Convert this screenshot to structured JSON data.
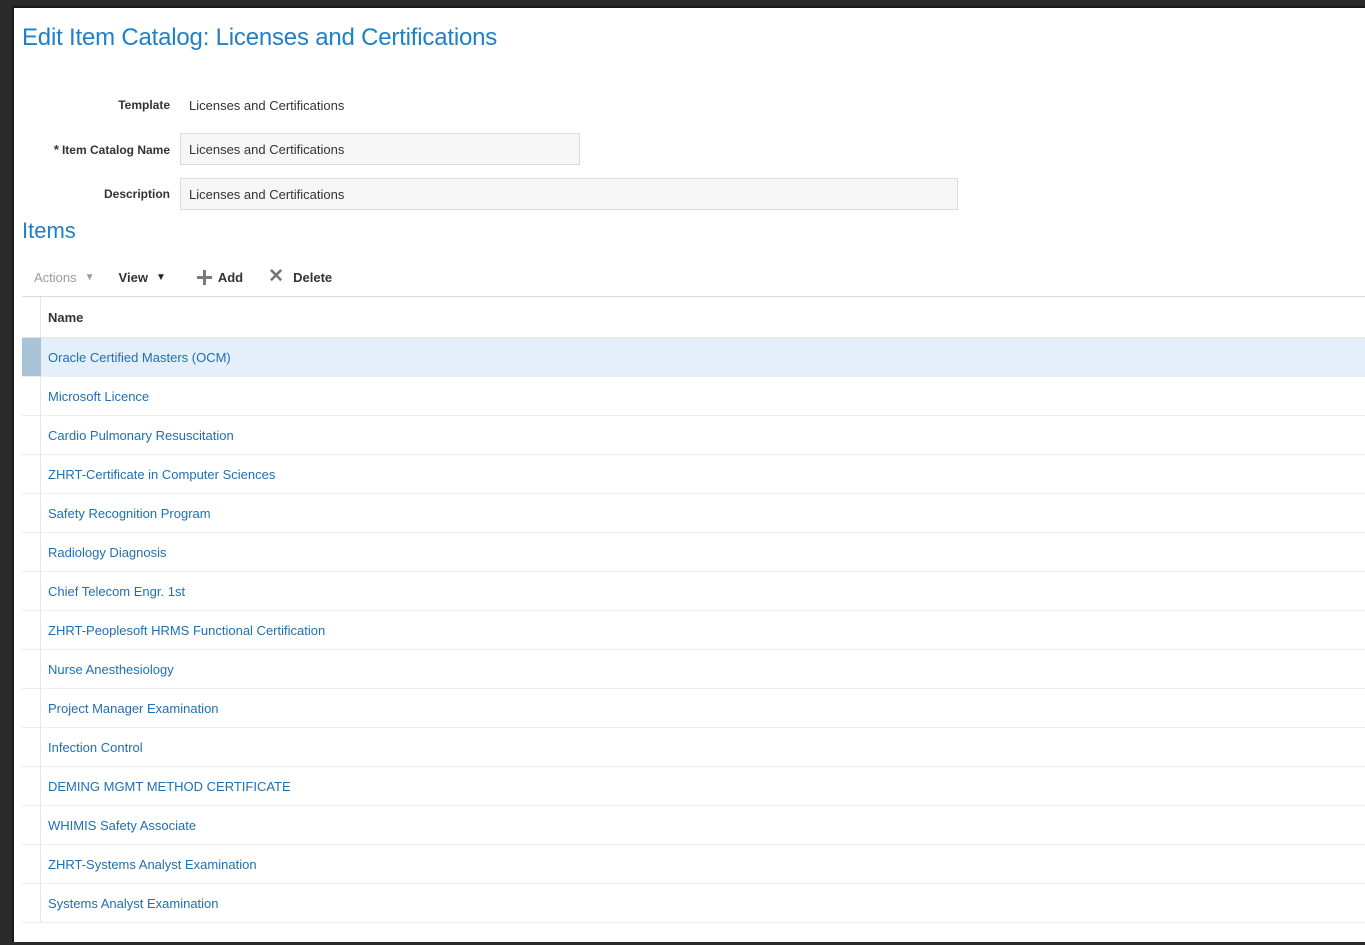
{
  "page": {
    "title": "Edit Item Catalog: Licenses and Certifications"
  },
  "form": {
    "template_label": "Template",
    "template_value": "Licenses and Certifications",
    "required_marker": "*",
    "name_label": "Item Catalog Name",
    "name_value": "Licenses and Certifications",
    "description_label": "Description",
    "description_value": "Licenses and Certifications"
  },
  "items_section": {
    "title": "Items",
    "toolbar": {
      "actions_label": "Actions",
      "view_label": "View",
      "add_label": "Add",
      "delete_label": "Delete",
      "actions_enabled": false
    },
    "columns": [
      "Name"
    ],
    "selected_index": 0,
    "rows": [
      "Oracle Certified Masters (OCM)",
      "Microsoft Licence",
      "Cardio Pulmonary Resuscitation",
      "ZHRT-Certificate in Computer Sciences",
      "Safety Recognition Program",
      "Radiology Diagnosis",
      "Chief Telecom Engr. 1st",
      "ZHRT-Peoplesoft HRMS Functional Certification",
      "Nurse Anesthesiology",
      "Project Manager Examination",
      "Infection Control",
      "DEMING MGMT METHOD CERTIFICATE",
      "WHIMIS Safety Associate",
      "ZHRT-Systems Analyst Examination",
      "Systems Analyst Examination"
    ]
  },
  "colors": {
    "accent": "#1f80c9",
    "link": "#1f6fb2",
    "selected_row": "#e4eff9"
  }
}
